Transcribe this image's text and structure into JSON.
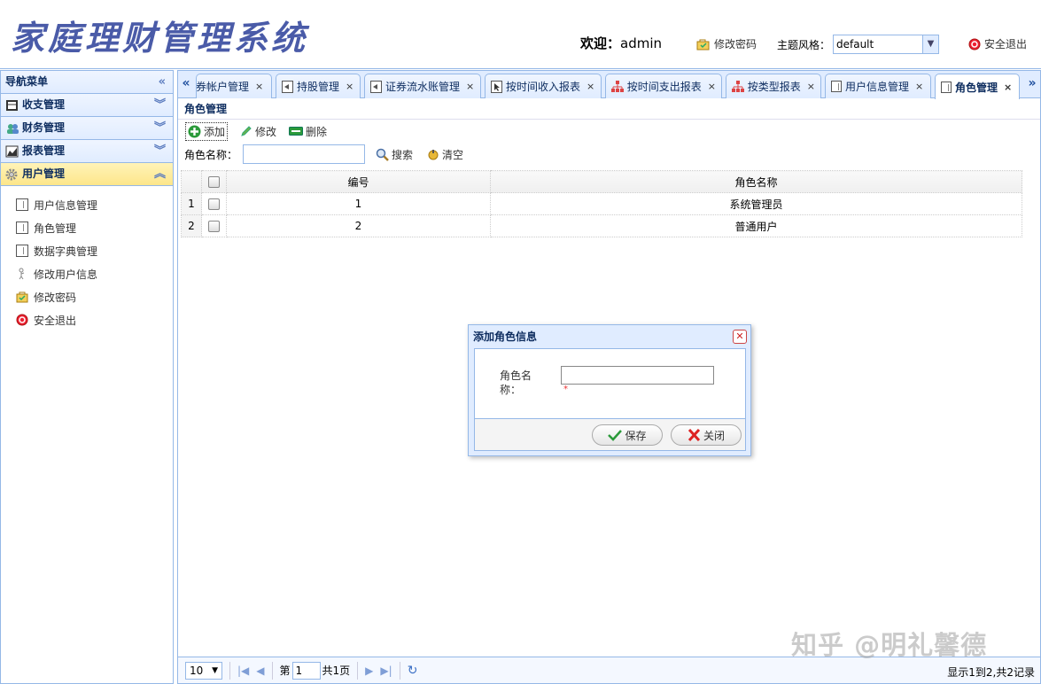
{
  "header": {
    "app_title": "家庭理财管理系统",
    "welcome_label": "欢迎：",
    "username": "admin",
    "change_password": "修改密码",
    "theme_label": "主题风格：",
    "theme_value": "default",
    "logout": "安全退出"
  },
  "sidebar": {
    "title": "导航菜单",
    "groups": [
      {
        "label": "收支管理"
      },
      {
        "label": "财务管理"
      },
      {
        "label": "报表管理"
      },
      {
        "label": "用户管理"
      }
    ],
    "items": [
      {
        "label": "用户信息管理"
      },
      {
        "label": "角色管理"
      },
      {
        "label": "数据字典管理"
      },
      {
        "label": "修改用户信息"
      },
      {
        "label": "修改密码"
      },
      {
        "label": "安全退出"
      }
    ]
  },
  "tabs": [
    {
      "label": "证券帐户管理"
    },
    {
      "label": "持股管理"
    },
    {
      "label": "证券流水账管理"
    },
    {
      "label": "按时间收入报表"
    },
    {
      "label": "按时间支出报表"
    },
    {
      "label": "按类型报表"
    },
    {
      "label": "用户信息管理"
    },
    {
      "label": "角色管理"
    }
  ],
  "content": {
    "title": "角色管理",
    "toolbar": {
      "add": "添加",
      "edit": "修改",
      "delete": "删除"
    },
    "search": {
      "label": "角色名称：",
      "value": "",
      "search_btn": "搜索",
      "clear_btn": "清空"
    }
  },
  "grid": {
    "columns": [
      "编号",
      "角色名称"
    ],
    "rows": [
      {
        "rownum": "1",
        "id": "1",
        "name": "系统管理员"
      },
      {
        "rownum": "2",
        "id": "2",
        "name": "普通用户"
      }
    ]
  },
  "pager": {
    "page_size": "10",
    "page_prefix": "第",
    "page_num": "1",
    "page_total": "共1页",
    "info": "显示1到2,共2记录"
  },
  "dialog": {
    "title": "添加角色信息",
    "field_label": "角色名称：",
    "field_value": "",
    "required_mark": "*",
    "save": "保存",
    "close": "关闭"
  },
  "watermark": "知乎 @明礼馨德"
}
